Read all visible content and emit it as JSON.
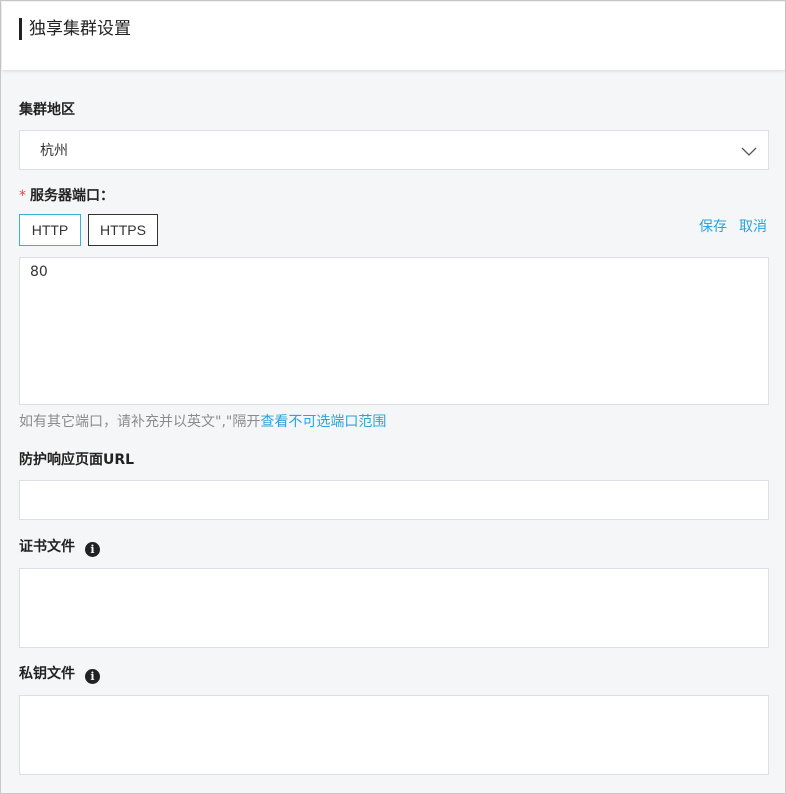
{
  "header": {
    "title": "独享集群设置"
  },
  "region": {
    "label": "集群地区",
    "value": "杭州"
  },
  "port": {
    "required_mark": "*",
    "label": "服务器端口：",
    "tabs": [
      "HTTP",
      "HTTPS"
    ],
    "save_label": "保存",
    "cancel_label": "取消",
    "value": "80",
    "hint_text": "如有其它端口，请补充并以英文\",\"隔开",
    "hint_link": "查看不可选端口范围"
  },
  "protect_url": {
    "label": "防护响应页面URL",
    "value": ""
  },
  "cert": {
    "label": "证书文件",
    "value": ""
  },
  "private_key": {
    "label": "私钥文件",
    "value": ""
  },
  "icons": {
    "dropdown": "chevron-down-icon",
    "info": "info-icon"
  },
  "colors": {
    "accent": "#2aa4db",
    "required": "#e8443a",
    "http_border": "#3bb1d9"
  }
}
